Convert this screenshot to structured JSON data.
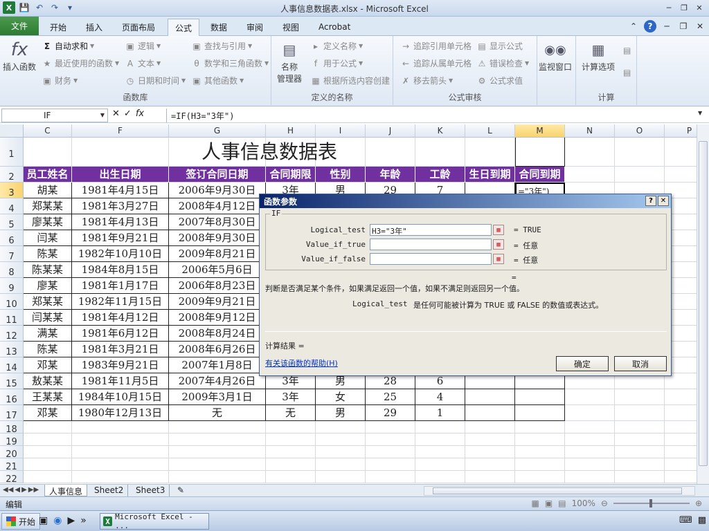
{
  "window": {
    "title": "人事信息数据表.xlsx - Microsoft Excel",
    "logo": "X"
  },
  "ribbon_tabs": [
    "文件",
    "开始",
    "插入",
    "页面布局",
    "公式",
    "数据",
    "审阅",
    "视图",
    "Acrobat"
  ],
  "ribbon": {
    "insert_function": "插入函数",
    "autosum": "自动求和",
    "recent": "最近使用的函数",
    "finance": "财务",
    "logic": "逻辑",
    "text": "文本",
    "datetime": "日期和时间",
    "lookup": "查找与引用",
    "math": "数学和三角函数",
    "other": "其他函数",
    "group_library": "函数库",
    "name_manager_1": "名称",
    "name_manager_2": "管理器",
    "define_name": "定义名称",
    "use_in_formula": "用于公式",
    "create_from_selection": "根据所选内容创建",
    "group_names": "定义的名称",
    "trace_precedents": "追踪引用单元格",
    "trace_dependents": "追踪从属单元格",
    "remove_arrows": "移去箭头",
    "show_formulas": "显示公式",
    "error_checking": "错误检查",
    "evaluate_formula": "公式求值",
    "group_audit": "公式审核",
    "watch_window": "监视窗口",
    "calc_options": "计算选项",
    "group_calc": "计算"
  },
  "formula_bar": {
    "name_box": "IF",
    "formula": "=IF(H3=\"3年\")"
  },
  "columns": [
    "C",
    "F",
    "G",
    "H",
    "I",
    "J",
    "K",
    "L",
    "M",
    "N",
    "O",
    "P"
  ],
  "rows": [
    "1",
    "2",
    "3",
    "4",
    "5",
    "6",
    "7",
    "8",
    "9",
    "10",
    "11",
    "12",
    "13",
    "14",
    "15",
    "16",
    "17",
    "18",
    "19",
    "20",
    "21",
    "22"
  ],
  "sheet": {
    "title": "人事信息数据表",
    "headers": [
      "员工姓名",
      "出生日期",
      "签订合同日期",
      "合同期限",
      "性别",
      "年龄",
      "工龄",
      "生日到期",
      "合同到期"
    ],
    "records": [
      [
        "胡某",
        "1981年4月15日",
        "2006年9月30日",
        "3年",
        "男",
        "29",
        "7",
        "",
        "=\"3年\")"
      ],
      [
        "郑某某",
        "1981年3月27日",
        "2008年4月12日",
        "",
        "",
        "",
        "",
        "",
        ""
      ],
      [
        "廖某某",
        "1981年4月13日",
        "2007年8月30日",
        "",
        "",
        "",
        "",
        "",
        ""
      ],
      [
        "闫某",
        "1981年9月21日",
        "2008年9月30日",
        "",
        "",
        "",
        "",
        "",
        ""
      ],
      [
        "陈某",
        "1982年10月10日",
        "2009年8月21日",
        "",
        "",
        "",
        "",
        "",
        ""
      ],
      [
        "陈某某",
        "1984年8月15日",
        "2006年5月6日",
        "",
        "",
        "",
        "",
        "",
        ""
      ],
      [
        "廖某",
        "1981年1月17日",
        "2006年8月23日",
        "",
        "",
        "",
        "",
        "",
        ""
      ],
      [
        "郑某某",
        "1982年11月15日",
        "2009年9月21日",
        "",
        "",
        "",
        "",
        "",
        ""
      ],
      [
        "闫某某",
        "1981年4月12日",
        "2008年9月12日",
        "",
        "",
        "",
        "",
        "",
        ""
      ],
      [
        "满某",
        "1981年6月12日",
        "2008年8月24日",
        "",
        "",
        "",
        "",
        "",
        ""
      ],
      [
        "陈某",
        "1981年3月21日",
        "2008年6月26日",
        "",
        "",
        "",
        "",
        "",
        ""
      ],
      [
        "邓某",
        "1983年9月21日",
        "2007年1月8日",
        "",
        "",
        "",
        "",
        "",
        ""
      ],
      [
        "敖某某",
        "1981年11月5日",
        "2007年4月26日",
        "3年",
        "男",
        "28",
        "6",
        "",
        ""
      ],
      [
        "王某某",
        "1984年10月15日",
        "2009年3月1日",
        "3年",
        "女",
        "25",
        "4",
        "",
        ""
      ],
      [
        "邓某",
        "1980年12月13日",
        "无",
        "无",
        "男",
        "29",
        "1",
        "",
        ""
      ]
    ]
  },
  "sheet_tabs": [
    "人事信息",
    "Sheet2",
    "Sheet3"
  ],
  "status": {
    "mode": "编辑",
    "zoom": "100%"
  },
  "taskbar": {
    "start": "开始",
    "app": "Microsoft Excel - ..."
  },
  "dialog": {
    "title": "函数参数",
    "function": "IF",
    "args": [
      {
        "label": "Logical_test",
        "value": "H3=\"3年\"",
        "result": "=  TRUE"
      },
      {
        "label": "Value_if_true",
        "value": "",
        "result": "=  任意"
      },
      {
        "label": "Value_if_false",
        "value": "",
        "result": "=  任意"
      }
    ],
    "overall_result": "=",
    "description": "判断是否满足某个条件，如果满足返回一个值，如果不满足则返回另一个值。",
    "arg_help_name": "Logical_test",
    "arg_help_text": "是任何可能被计算为 TRUE 或 FALSE 的数值或表达式。",
    "calc_result": "计算结果 =",
    "help_link": "有关该函数的帮助(H)",
    "ok": "确定",
    "cancel": "取消"
  }
}
